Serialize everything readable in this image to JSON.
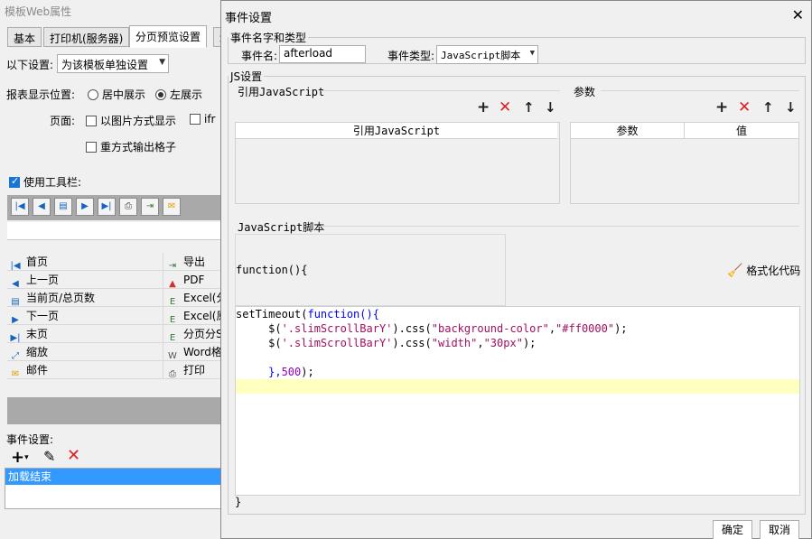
{
  "bg": {
    "title": "模板Web属性",
    "tabs": [
      "基本",
      "打印机(服务器)",
      "分页预览设置",
      "填"
    ],
    "setting_label": "以下设置:",
    "setting_value": "为该模板单独设置",
    "display_pos_label": "报表显示位置:",
    "radio_center": "居中展示",
    "radio_left": "左展示",
    "page_label": "页面:",
    "check_image": "以图片方式显示",
    "check_iframe": "ifr",
    "check_repeat": "重方式输出格子",
    "use_toolbar": "使用工具栏:",
    "table_left": [
      "首页",
      "上一页",
      "当前页/总页数",
      "下一页",
      "末页",
      "缩放",
      "邮件"
    ],
    "table_right": [
      "导出",
      "PDF",
      "Excel(分",
      "Excel(原",
      "分页分Sh",
      "Word格式",
      "打印"
    ],
    "event_label": "事件设置:",
    "event_item": "加载结束"
  },
  "dialog": {
    "title": "事件设置",
    "name_group": "事件名字和类型",
    "event_name_label": "事件名:",
    "event_name_value": "afterload",
    "event_type_label": "事件类型:",
    "event_type_value": "JavaScript脚本",
    "js_group": "JS设置",
    "ref_js_head": "引用JavaScript",
    "params_head": "参数",
    "ref_js_col": "引用JavaScript",
    "param_col": "参数",
    "value_col": "值",
    "script_head": "JavaScript脚本",
    "fn_label": "function(){",
    "format_label": "格式化代码",
    "close_brace": "}",
    "ok": "确定",
    "cancel": "取消"
  },
  "code": {
    "l1_fn": "setTimeout(",
    "l1_kw": "function",
    "l1_end": "(){",
    "l2_pre": "     $(",
    "l2_sel": "'.slimScrollBarY'",
    "l2_mid": ").css(",
    "l2_a": "\"background-color\"",
    "l2_comma": ",",
    "l2_b": "\"#ff0000\"",
    "l2_end": ");",
    "l3_pre": "     $(",
    "l3_sel": "'.slimScrollBarY'",
    "l3_mid": ").css(",
    "l3_a": "\"width\"",
    "l3_comma": ",",
    "l3_b": "\"30px\"",
    "l3_end": ");",
    "l5_pre": "     },",
    "l5_num": "500",
    "l5_end": ");"
  },
  "colors": {
    "delete": "#e02020",
    "selection": "#3399ff",
    "current_line": "#ffffc0",
    "keyword": "#0000ff"
  }
}
